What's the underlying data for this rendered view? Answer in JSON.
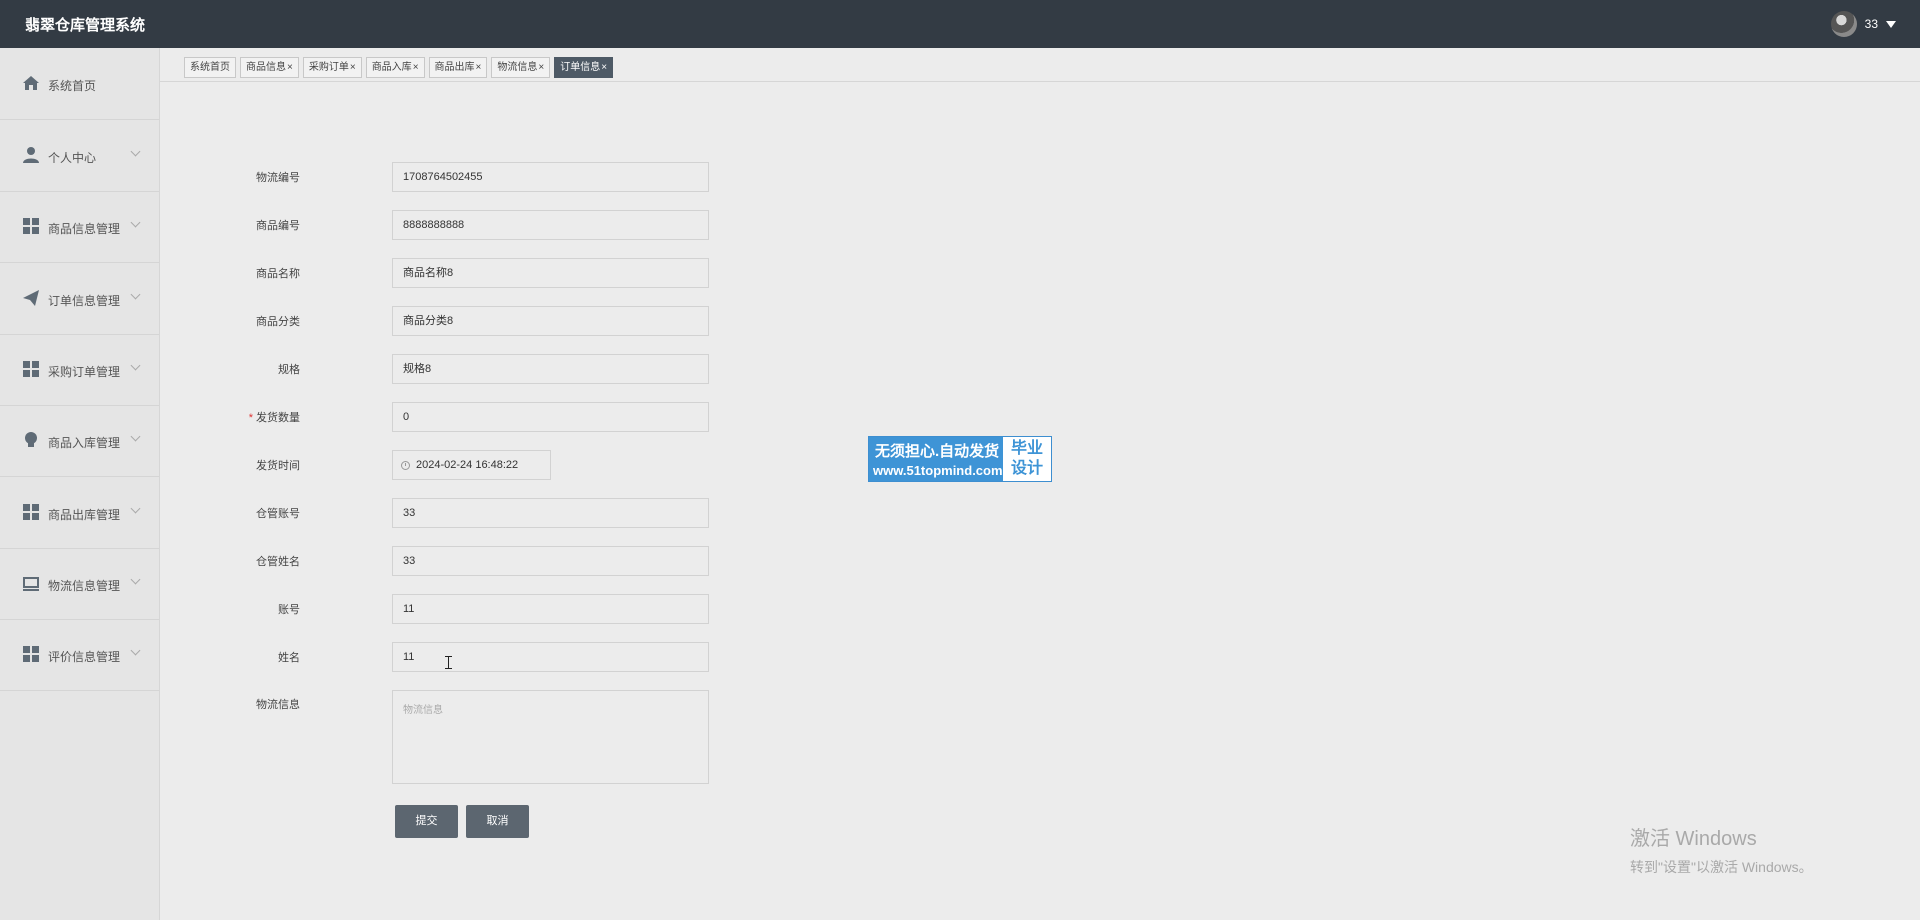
{
  "app": {
    "title": "翡翠仓库管理系统",
    "user": "33"
  },
  "sidebar": {
    "items": [
      {
        "label": "系统首页",
        "icon": "home-icon"
      },
      {
        "label": "个人中心",
        "icon": "person-icon"
      },
      {
        "label": "商品信息管理",
        "icon": "grid-icon"
      },
      {
        "label": "订单信息管理",
        "icon": "paper-plane-icon"
      },
      {
        "label": "采购订单管理",
        "icon": "grid-icon"
      },
      {
        "label": "商品入库管理",
        "icon": "bulb-icon"
      },
      {
        "label": "商品出库管理",
        "icon": "grid-icon"
      },
      {
        "label": "物流信息管理",
        "icon": "inbox-icon"
      },
      {
        "label": "评价信息管理",
        "icon": "grid-icon"
      }
    ]
  },
  "tabs": [
    {
      "label": "系统首页",
      "closable": false,
      "active": false
    },
    {
      "label": "商品信息",
      "closable": true,
      "active": false
    },
    {
      "label": "采购订单",
      "closable": true,
      "active": false
    },
    {
      "label": "商品入库",
      "closable": true,
      "active": false
    },
    {
      "label": "商品出库",
      "closable": true,
      "active": false
    },
    {
      "label": "物流信息",
      "closable": true,
      "active": false
    },
    {
      "label": "订单信息",
      "closable": true,
      "active": true
    }
  ],
  "tab_close_glyph": "×",
  "form": {
    "fields": [
      {
        "label": "物流编号",
        "value": "1708764502455"
      },
      {
        "label": "商品编号",
        "value": "8888888888"
      },
      {
        "label": "商品名称",
        "value": "商品名称8"
      },
      {
        "label": "商品分类",
        "value": "商品分类8"
      },
      {
        "label": "规格",
        "value": "规格8"
      },
      {
        "label": "发货数量",
        "value": "0",
        "required": true,
        "required_mark": "*"
      },
      {
        "label": "发货时间",
        "value": "2024-02-24 16:48:22"
      },
      {
        "label": "仓管账号",
        "value": "33"
      },
      {
        "label": "仓管姓名",
        "value": "33"
      },
      {
        "label": "账号",
        "value": "11"
      },
      {
        "label": "姓名",
        "value": "11"
      }
    ],
    "logistics_label": "物流信息",
    "logistics_placeholder": "物流信息",
    "submit": "提交",
    "cancel": "取消"
  },
  "promo": {
    "line1": "无须担心.自动发货",
    "line2": "www.51topmind.com",
    "right1": "毕业",
    "right2": "设计"
  },
  "watermark": {
    "line1": "激活 Windows",
    "line2": "转到\"设置\"以激活 Windows。"
  },
  "colors": {
    "topbar": "#333b44",
    "active_tab": "#4e5a66",
    "button": "#5c6670",
    "promo_blue": "#3e94d6",
    "required": "#dd3333"
  }
}
